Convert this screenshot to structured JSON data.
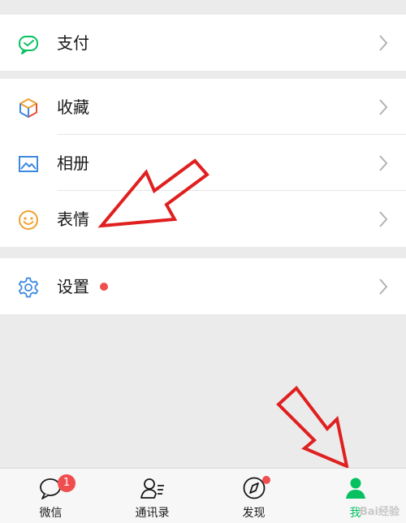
{
  "menu": {
    "pay": {
      "label": "支付",
      "icon": "wechat-pay-icon"
    },
    "favorites": {
      "label": "收藏",
      "icon": "cube-icon"
    },
    "album": {
      "label": "相册",
      "icon": "picture-icon"
    },
    "stickers": {
      "label": "表情",
      "icon": "smiley-icon"
    },
    "settings": {
      "label": "设置",
      "icon": "gear-icon",
      "has_red_dot": true
    }
  },
  "tabbar": {
    "chats": {
      "label": "微信",
      "badge": "1",
      "icon": "chat-bubble-icon"
    },
    "contacts": {
      "label": "通讯录",
      "icon": "contacts-icon"
    },
    "discover": {
      "label": "发现",
      "icon": "compass-icon",
      "has_red_dot": true
    },
    "me": {
      "label": "我",
      "icon": "person-icon",
      "active": true
    }
  },
  "watermark": "Bai经验",
  "colors": {
    "accent": "#07c160",
    "badge": "#f04d4f",
    "annotation": "#e02020"
  }
}
